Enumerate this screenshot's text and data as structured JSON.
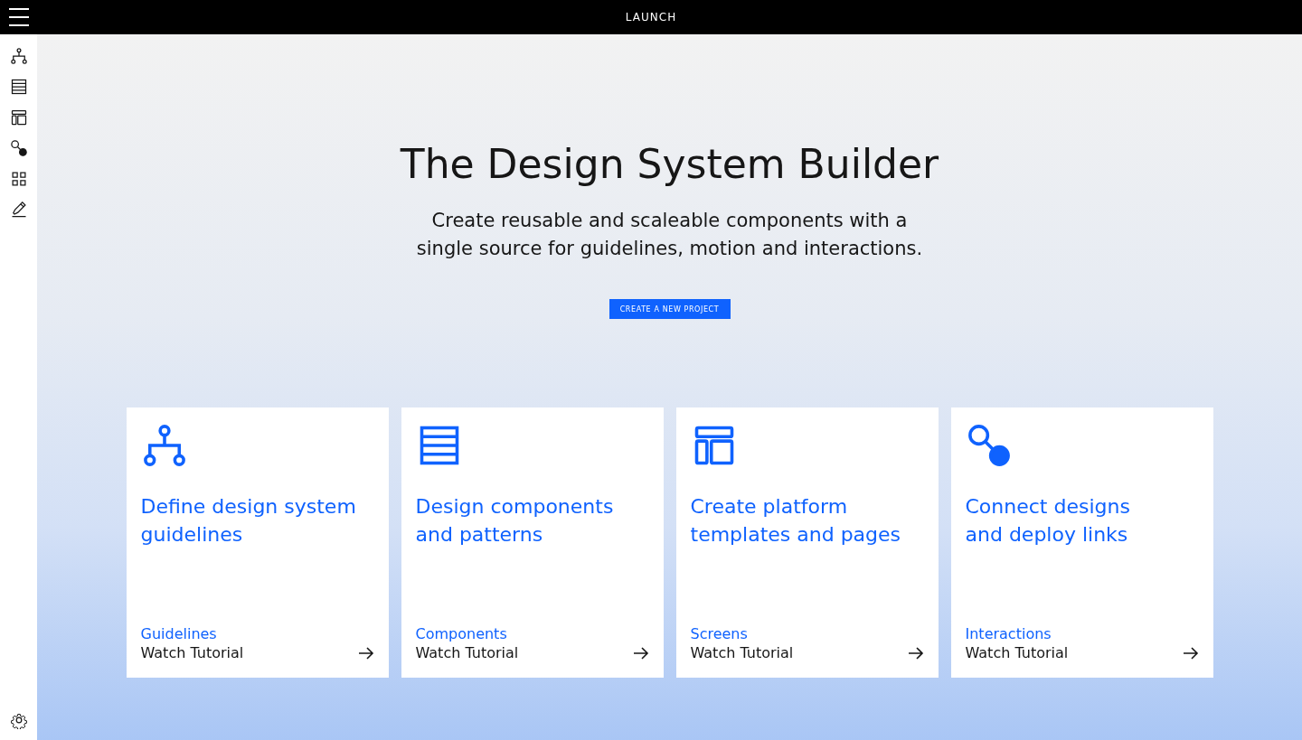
{
  "top_bar": {
    "title": "LAUNCH"
  },
  "sidebar": {
    "items": [
      {
        "kind": "tree"
      },
      {
        "kind": "table"
      },
      {
        "kind": "layout"
      },
      {
        "kind": "connect"
      },
      {
        "kind": "grid"
      },
      {
        "kind": "pencil"
      }
    ],
    "footer_items": [
      {
        "kind": "gear"
      }
    ]
  },
  "hero": {
    "title": "The Design System Builder",
    "subtitle": "Create reusable and scaleable components with a\nsingle source for guidelines, motion and interactions.",
    "button": "CREATE A NEW PROJECT"
  },
  "cards": [
    {
      "kind": "tree",
      "title": "Define design system\nguidelines",
      "category": "Guidelines",
      "link": "Watch Tutorial"
    },
    {
      "kind": "table",
      "title": "Design components\nand patterns",
      "category": "Components",
      "link": "Watch Tutorial"
    },
    {
      "kind": "layout",
      "title": "Create platform\ntemplates and pages",
      "category": "Screens",
      "link": "Watch Tutorial"
    },
    {
      "kind": "connect",
      "title": "Connect designs\nand deploy links",
      "category": "Interactions",
      "link": "Watch Tutorial"
    }
  ]
}
